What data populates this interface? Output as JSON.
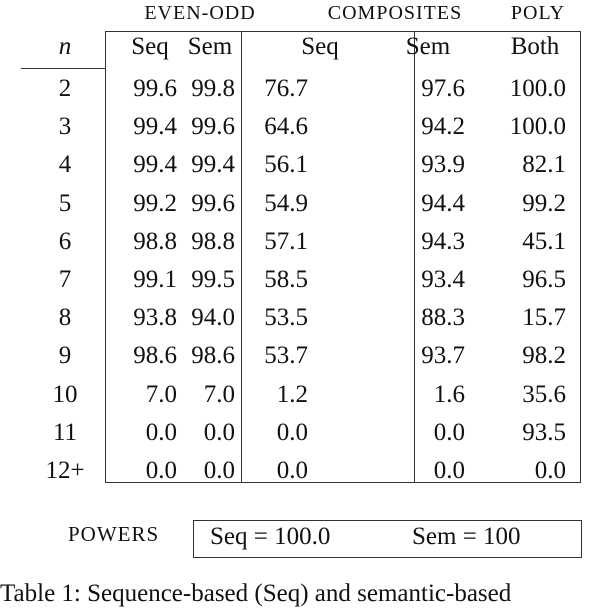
{
  "table": {
    "groups": [
      {
        "label": "EVEN-ODD"
      },
      {
        "label": "COMPOSITES"
      },
      {
        "label": "POLY"
      }
    ],
    "columns": [
      "n",
      "Seq",
      "Sem",
      "Seq",
      "Sem",
      "Both"
    ],
    "rows": [
      {
        "n": "2",
        "cells": [
          "99.6",
          "99.8",
          "76.7",
          "97.6",
          "100.0"
        ]
      },
      {
        "n": "3",
        "cells": [
          "99.4",
          "99.6",
          "64.6",
          "94.2",
          "100.0"
        ]
      },
      {
        "n": "4",
        "cells": [
          "99.4",
          "99.4",
          "56.1",
          "93.9",
          "82.1"
        ]
      },
      {
        "n": "5",
        "cells": [
          "99.2",
          "99.6",
          "54.9",
          "94.4",
          "99.2"
        ]
      },
      {
        "n": "6",
        "cells": [
          "98.8",
          "98.8",
          "57.1",
          "94.3",
          "45.1"
        ]
      },
      {
        "n": "7",
        "cells": [
          "99.1",
          "99.5",
          "58.5",
          "93.4",
          "96.5"
        ]
      },
      {
        "n": "8",
        "cells": [
          "93.8",
          "94.0",
          "53.5",
          "88.3",
          "15.7"
        ]
      },
      {
        "n": "9",
        "cells": [
          "98.6",
          "98.6",
          "53.7",
          "93.7",
          "98.2"
        ]
      },
      {
        "n": "10",
        "cells": [
          "7.0",
          "7.0",
          "1.2",
          "1.6",
          "35.6"
        ]
      },
      {
        "n": "11",
        "cells": [
          "0.0",
          "0.0",
          "0.0",
          "0.0",
          "93.5"
        ]
      },
      {
        "n": "12+",
        "cells": [
          "0.0",
          "0.0",
          "0.0",
          "0.0",
          "0.0"
        ]
      }
    ]
  },
  "powers": {
    "label": "POWERS",
    "seq": "Seq = 100.0",
    "sem": "Sem = 100"
  },
  "caption": "Table 1:   Sequence-based (Seq) and semantic-based"
}
